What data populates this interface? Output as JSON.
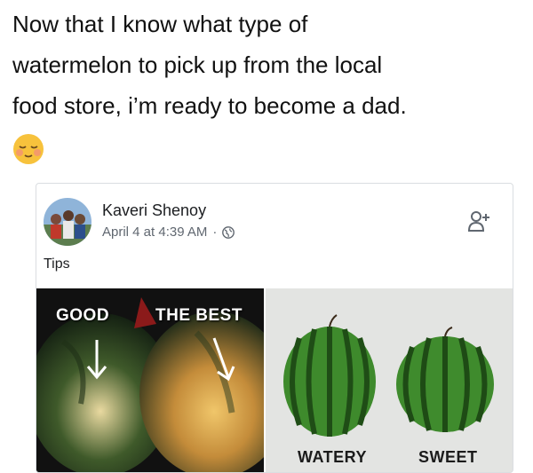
{
  "caption": {
    "line1": "Now that I know what type of",
    "line2": "watermelon to pick up from the local",
    "line3": "food store, i’m ready to become a dad."
  },
  "emoji": "relieved-face-emoji",
  "post": {
    "author": "Kaveri Shenoy",
    "timestamp": "April 4 at 4:39 AM",
    "separator": "·",
    "privacy_icon": "globe-icon",
    "action_icon": "add-friend-icon",
    "text": "Tips"
  },
  "image_left": {
    "label_good": "GOOD",
    "label_best": "THE BEST"
  },
  "image_right": {
    "label_watery": "WATERY",
    "label_sweet": "SWEET"
  }
}
